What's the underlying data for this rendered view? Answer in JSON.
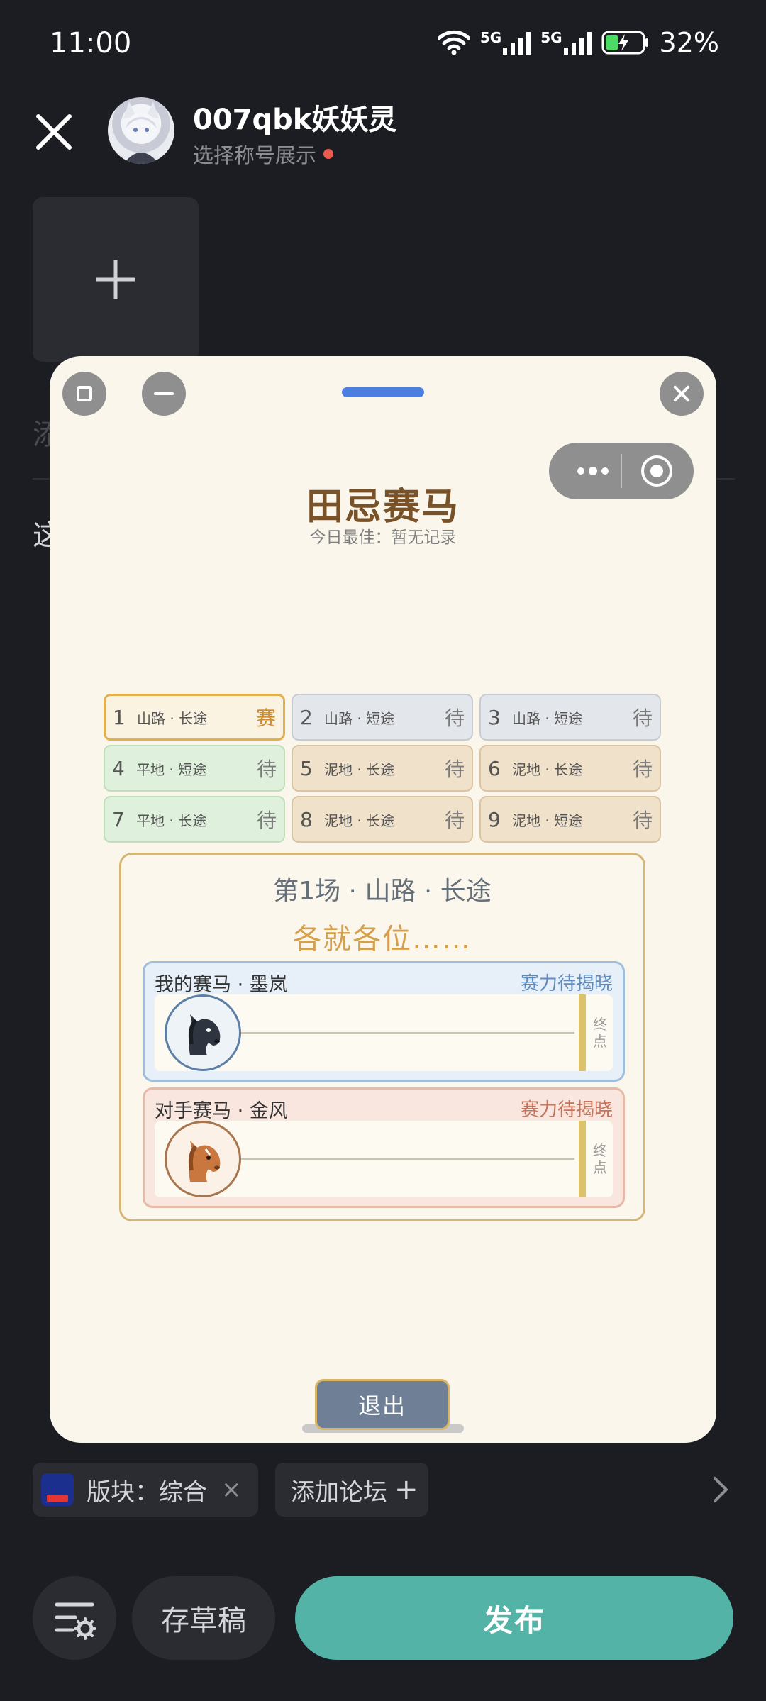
{
  "status_bar": {
    "time": "11:00",
    "network_1": "5G",
    "network_2": "5G",
    "battery": "32%"
  },
  "header": {
    "username": "007qbk妖妖灵",
    "subtitle": "选择称号展示"
  },
  "background_hint": {
    "text_a": "添",
    "text_b": "这"
  },
  "mini_program": {
    "title": "田忌赛马",
    "best_today": "今日最佳：暂无记录",
    "races": [
      {
        "no": "1",
        "desc": "山路 · 长途",
        "status": "赛",
        "terrain": "mountain",
        "active": true
      },
      {
        "no": "2",
        "desc": "山路 · 短途",
        "status": "待",
        "terrain": "mountain",
        "active": false
      },
      {
        "no": "3",
        "desc": "山路 · 短途",
        "status": "待",
        "terrain": "mountain",
        "active": false
      },
      {
        "no": "4",
        "desc": "平地 · 短途",
        "status": "待",
        "terrain": "flat",
        "active": false
      },
      {
        "no": "5",
        "desc": "泥地 · 长途",
        "status": "待",
        "terrain": "mud",
        "active": false
      },
      {
        "no": "6",
        "desc": "泥地 · 长途",
        "status": "待",
        "terrain": "mud",
        "active": false
      },
      {
        "no": "7",
        "desc": "平地 · 长途",
        "status": "待",
        "terrain": "flat",
        "active": false
      },
      {
        "no": "8",
        "desc": "泥地 · 长途",
        "status": "待",
        "terrain": "mud",
        "active": false
      },
      {
        "no": "9",
        "desc": "泥地 · 短途",
        "status": "待",
        "terrain": "mud",
        "active": false
      }
    ],
    "panel": {
      "title": "第1场 · 山路 · 长途",
      "status": "各就各位……",
      "my_horse": {
        "name": "我的赛马 · 墨岚",
        "power": "赛力待揭晓",
        "finish": "终点"
      },
      "rival_horse": {
        "name": "对手赛马 · 金风",
        "power": "赛力待揭晓",
        "finish": "终点"
      }
    },
    "exit_label": "退出"
  },
  "bottom": {
    "board_label": "版块：综合",
    "board_remove": "×",
    "add_forum": "添加论坛",
    "add_plus": "+",
    "draft_label": "存草稿",
    "publish_label": "发布"
  },
  "colors": {
    "publish": "#52b3a6",
    "accent_gold": "#d5a04e",
    "card_bg": "#fbf6ec"
  }
}
